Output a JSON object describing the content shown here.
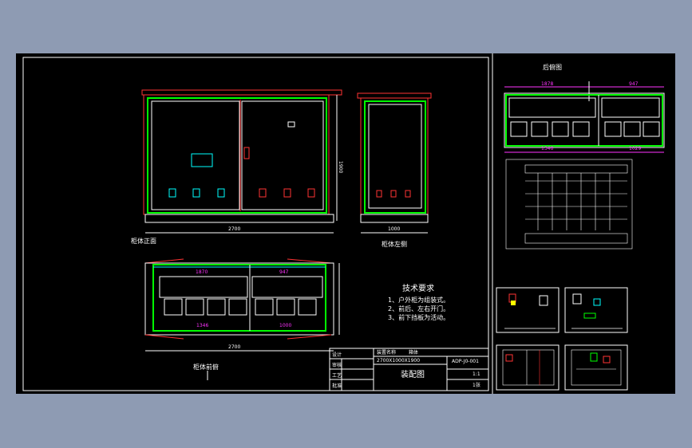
{
  "drawing": {
    "views": {
      "front": {
        "label": "柜体正面",
        "width": "2700",
        "height": "1900"
      },
      "left": {
        "label": "柜体左侧",
        "width": "1000"
      },
      "top": {
        "label": "柜体前俯",
        "width": "2700",
        "dim_a": "1870",
        "dim_b": "947",
        "dim_c": "1346",
        "dim_d": "1000"
      },
      "rear": {
        "label": "后俯图",
        "dim_a": "1878",
        "dim_b": "947",
        "dim_c": "1346",
        "dim_d": "1029"
      }
    },
    "tech": {
      "title": "技术要求",
      "items": [
        "1、户外柜为组装式。",
        "2、前后、左右开门。",
        "3、前下挡板为活动。"
      ]
    },
    "title_block": {
      "product_label": "装置名称",
      "product_value": "箱体",
      "spec": "2700X1000X1900",
      "drawing_no": "ADP-J0-001",
      "drawing_name": "装配图",
      "scale": "1:1",
      "sheet": "1张",
      "rows": [
        "设计",
        "审核",
        "工艺",
        "批准"
      ]
    },
    "colors": {
      "background": "#000000",
      "outline": "#ffffff",
      "frame": "#00ff00",
      "roof": "#ff3333",
      "dimension": "#ff33ff",
      "accent": "#00ffff",
      "window": "#8e9bb3"
    }
  }
}
